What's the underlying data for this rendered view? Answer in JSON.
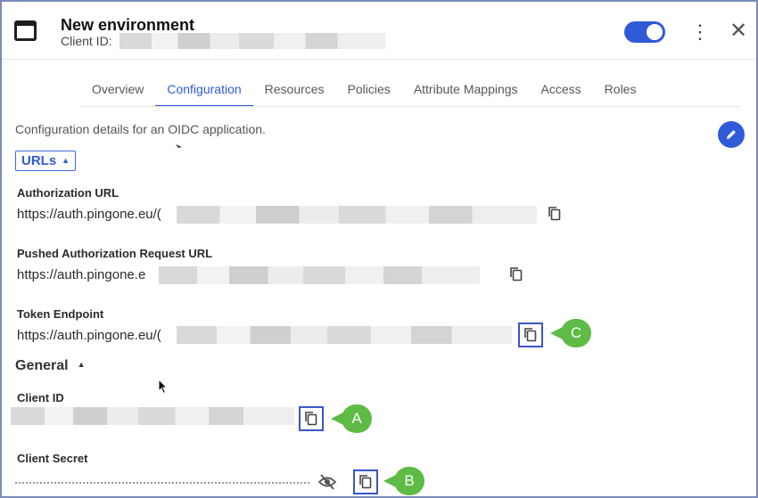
{
  "header": {
    "title": "New environment",
    "client_id_label": "Client ID:",
    "enabled": true
  },
  "tabs": [
    {
      "label": "Overview",
      "active": false
    },
    {
      "label": "Configuration",
      "active": true
    },
    {
      "label": "Resources",
      "active": false
    },
    {
      "label": "Policies",
      "active": false
    },
    {
      "label": "Attribute Mappings",
      "active": false
    },
    {
      "label": "Access",
      "active": false
    },
    {
      "label": "Roles",
      "active": false
    }
  ],
  "description": "Configuration details for an OIDC application.",
  "urls_section": {
    "label": "URLs",
    "fields": {
      "authorization_url": {
        "label": "Authorization URL",
        "value": "https://auth.pingone.eu/("
      },
      "par_url": {
        "label": "Pushed Authorization Request URL",
        "value": "https://auth.pingone.e"
      },
      "token_endpoint": {
        "label": "Token Endpoint",
        "value": "https://auth.pingone.eu/("
      }
    }
  },
  "general_section": {
    "label": "General",
    "client_id": {
      "label": "Client ID"
    },
    "client_secret": {
      "label": "Client Secret"
    }
  },
  "callouts": {
    "a": "A",
    "b": "B",
    "c": "C"
  },
  "colors": {
    "accent": "#2f5bd9",
    "callout": "#5dbb46",
    "highlight_box": "#3a56c8"
  },
  "icons": [
    "app-icon",
    "kebab-menu-icon",
    "close-icon",
    "pencil-icon",
    "copy-icon",
    "eye-off-icon",
    "caret-up-icon"
  ]
}
